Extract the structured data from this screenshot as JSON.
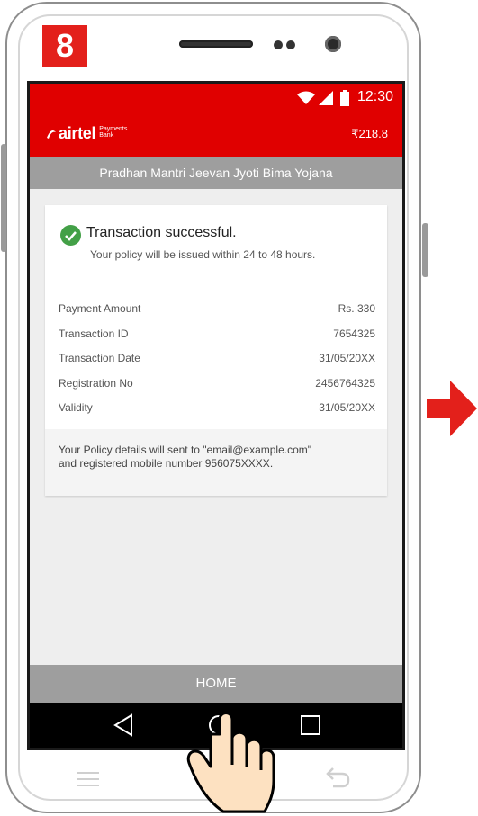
{
  "step": {
    "number": "8",
    "color": "#e3201b"
  },
  "status_bar": {
    "time": "12:30",
    "icons": [
      "wifi-icon",
      "signal-icon",
      "battery-icon"
    ]
  },
  "app_bar": {
    "logo_name": "airtel",
    "logo_sub": "Payments Bank",
    "balance": "₹218.8",
    "color": "#e00000"
  },
  "page": {
    "title": "Pradhan Mantri Jeevan Jyoti Bima Yojana"
  },
  "receipt": {
    "title": "Transaction successful.",
    "subtitle": "Your policy will be issued within 24 to 48 hours.",
    "rows": [
      {
        "label": "Payment Amount",
        "value": "Rs. 330"
      },
      {
        "label": "Transaction ID",
        "value": "7654325"
      },
      {
        "label": "Transaction Date",
        "value": "31/05/20XX"
      },
      {
        "label": "Registration No",
        "value": "2456764325"
      },
      {
        "label": "Validity",
        "value": "31/05/20XX"
      }
    ],
    "note_line1": "Your Policy details will sent to \"email@example.com\"",
    "note_line2": "and registered mobile number 956075XXXX."
  },
  "home_button": {
    "label": "HOME"
  },
  "nav": {
    "icons": [
      "back-triangle-icon",
      "home-circle-icon",
      "recent-square-icon"
    ]
  },
  "accent_success": "#43a047"
}
